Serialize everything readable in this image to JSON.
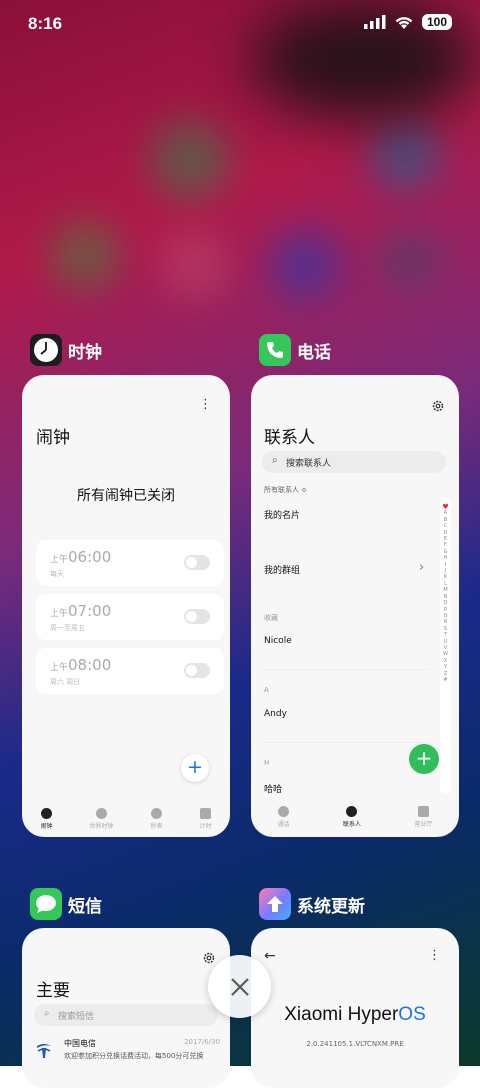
{
  "status": {
    "time": "8:16",
    "battery": "100"
  },
  "clock_app": {
    "name": "时钟",
    "header": "闹钟",
    "empty_message": "所有闹钟已关闭",
    "alarms": [
      {
        "ampm": "上午",
        "time": "06:00",
        "repeat": "每天"
      },
      {
        "ampm": "上午",
        "time": "07:00",
        "repeat": "周一至周五"
      },
      {
        "ampm": "上午",
        "time": "08:00",
        "repeat": "周六 周日"
      }
    ],
    "tabs": [
      "闹钟",
      "世界时钟",
      "秒表",
      "计时"
    ]
  },
  "phone_app": {
    "name": "电话",
    "header": "联系人",
    "search_placeholder": "搜索联系人",
    "filter": "所有联系人 ≎",
    "my_card": "我的名片",
    "my_groups": "我的群组",
    "sections": [
      {
        "label": "收藏",
        "name": "Nicole"
      },
      {
        "label": "A",
        "name": "Andy"
      },
      {
        "label": "H",
        "name": "哈哈"
      }
    ],
    "alphabet": [
      "A",
      "B",
      "C",
      "D",
      "E",
      "F",
      "G",
      "H",
      "I",
      "J",
      "K",
      "L",
      "M",
      "N",
      "O",
      "P",
      "Q",
      "R",
      "S",
      "T",
      "U",
      "V",
      "W",
      "X",
      "Y",
      "Z",
      "#"
    ],
    "tabs": [
      "通话",
      "联系人",
      "营业厅"
    ]
  },
  "sms_app": {
    "name": "短信",
    "header": "主要",
    "search_placeholder": "搜索短信",
    "message": {
      "sender": "中国电信",
      "date": "2017/6/30",
      "preview": "欢迎参加积分兑换话费活动，每500分可兑换"
    }
  },
  "update_app": {
    "name": "系统更新",
    "os_name_prefix": "Xiaomi Hyper",
    "os_name_suffix": "OS",
    "version": "2.0.241105.1.VLTCNXM.PRE"
  }
}
